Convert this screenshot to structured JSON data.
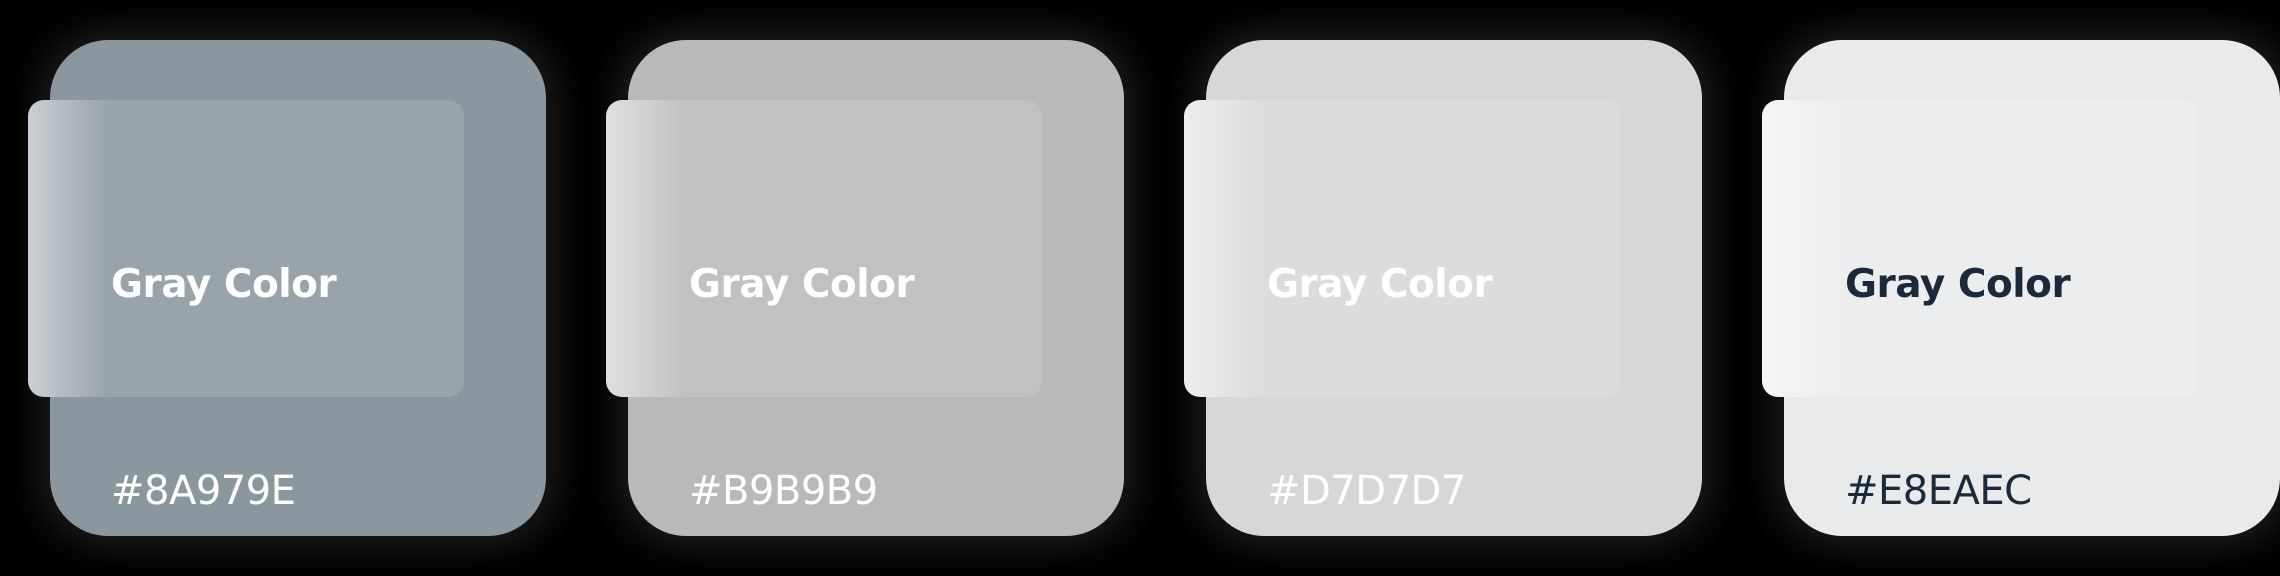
{
  "swatches": [
    {
      "title": "Gray Color",
      "hex": "#8A979E",
      "color": "#8A979E",
      "text_color": "#FFFFFF"
    },
    {
      "title": "Gray Color",
      "hex": "#B9B9B9",
      "color": "#B9B9B9",
      "text_color": "#FFFFFF"
    },
    {
      "title": "Gray Color",
      "hex": "#D7D7D7",
      "color": "#D7D7D7",
      "text_color": "#FFFFFF"
    },
    {
      "title": "Gray Color",
      "hex": "#E8EAEC",
      "color": "#E8EAEC",
      "text_color": "#1B2A3A"
    }
  ]
}
